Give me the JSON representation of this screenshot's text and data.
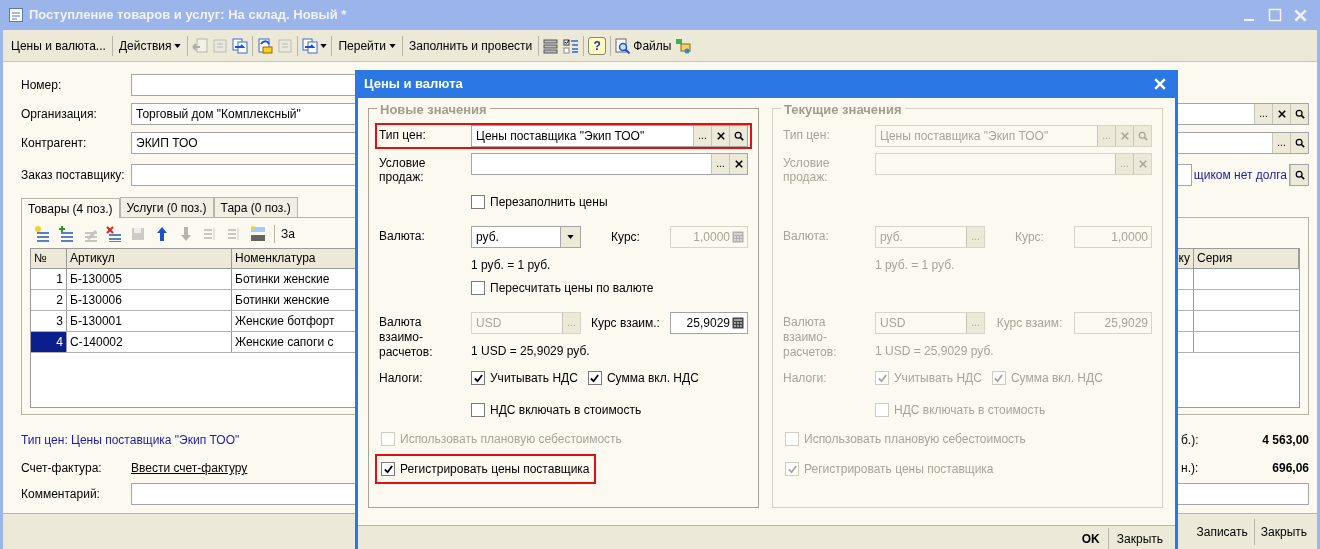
{
  "main_window": {
    "title": "Поступление товаров и услуг: На склад. Новый *",
    "toolbar": [
      [
        {
          "kind": "button",
          "label": "Цены и валюта..."
        }
      ],
      [
        {
          "kind": "menu",
          "label": "Действия"
        }
      ],
      [
        {
          "kind": "icon",
          "disabled": true
        },
        {
          "kind": "icon",
          "disabled": true
        },
        {
          "kind": "icon",
          "disabled": false
        }
      ],
      [
        {
          "kind": "icon",
          "disabled": false
        },
        {
          "kind": "icon",
          "disabled": true
        }
      ],
      [
        {
          "kind": "icon-menu",
          "disabled": false
        }
      ],
      [
        {
          "kind": "menu",
          "label": "Перейти"
        }
      ],
      [
        {
          "kind": "button",
          "label": "Заполнить и провести"
        }
      ],
      [
        {
          "kind": "icon",
          "disabled": false
        },
        {
          "kind": "icon",
          "disabled": false
        }
      ],
      [
        {
          "kind": "help",
          "label": "?"
        }
      ],
      [
        {
          "kind": "icon-button",
          "label": "Файлы"
        },
        {
          "kind": "icon",
          "disabled": false
        }
      ]
    ],
    "fields": [
      {
        "kind": "plain",
        "label": "Номер:"
      },
      {
        "kind": "ref",
        "label": "Организация:",
        "value": "Торговый дом \"Комплексный\"",
        "buttons": [
          {
            "kind": "choose",
            "label": "..."
          },
          {
            "kind": "clear"
          },
          {
            "kind": "open"
          }
        ]
      },
      {
        "kind": "ref",
        "label": "Контрагент:",
        "value": "ЭКИП ТОО",
        "buttons": [
          {
            "kind": "choose",
            "label": "..."
          },
          {
            "kind": "open"
          }
        ]
      },
      {
        "kind": "order",
        "label": "Заказ поставщику:",
        "link": "щиком нет долга",
        "buttons": [
          {
            "kind": "open"
          }
        ]
      }
    ],
    "tabs": [
      {
        "label": "Товары (4 поз.)",
        "selected": true
      },
      {
        "label": "Услуги (0 поз.)",
        "selected": false
      },
      {
        "label": "Тара (0 поз.)",
        "selected": false
      }
    ],
    "table_toolbar": [
      {
        "kind": "icon",
        "disabled": false
      },
      {
        "kind": "icon",
        "disabled": false
      },
      {
        "kind": "icon",
        "disabled": true
      },
      {
        "kind": "icon",
        "disabled": false
      },
      {
        "kind": "icon",
        "disabled": true
      },
      {
        "kind": "icon",
        "disabled": false
      },
      {
        "kind": "icon",
        "disabled": true
      },
      {
        "kind": "icon",
        "disabled": true
      },
      {
        "kind": "icon",
        "disabled": true
      },
      {
        "kind": "icon",
        "disabled": false
      },
      {
        "kind": "button",
        "label": "За"
      }
    ],
    "table": {
      "columns": [
        "№",
        "Артикул",
        "Номенклатура",
        "ку",
        "Серия"
      ],
      "rows": [
        {
          "n": "1",
          "article": "Б-130005",
          "name": "Ботинки женские",
          "selected": false
        },
        {
          "n": "2",
          "article": "Б-130006",
          "name": "Ботинки женские",
          "selected": false
        },
        {
          "n": "3",
          "article": "Б-130001",
          "name": "Женские ботфорт",
          "selected": false
        },
        {
          "n": "4",
          "article": "С-140002",
          "name": "Женские сапоги с",
          "selected": true
        }
      ]
    },
    "price_type_link": "Тип цен: Цены поставщика \"Экип ТОО\"",
    "invoice": {
      "label": "Счет-фактура:",
      "link": "Ввести счет-фактуру"
    },
    "totals": [
      {
        "label": "б.):",
        "value": "4 563,00"
      },
      {
        "label": "н.):",
        "value": "696,06"
      }
    ],
    "comment": {
      "label": "Комментарий:"
    },
    "buttons": [
      {
        "label": "Записать"
      },
      {
        "label": "Закрыть"
      }
    ]
  },
  "dialog": {
    "title": "Цены и валюта",
    "groups": [
      {
        "title": "Новые значения",
        "disabled": false
      },
      {
        "title": "Текущие значения",
        "disabled": true
      }
    ],
    "rows": [
      {
        "kind": "ref",
        "new": {
          "label": "Тип цен:",
          "value": "Цены поставщика \"Экип ТОО\"",
          "highlighted": true,
          "buttons": [
            {
              "kind": "choose",
              "label": "..."
            },
            {
              "kind": "clear"
            },
            {
              "kind": "open"
            }
          ]
        },
        "current": {
          "label": "Тип цен:",
          "value": "Цены поставщика \"Экип ТОО\"",
          "buttons": [
            {
              "kind": "choose",
              "label": "..."
            },
            {
              "kind": "clear"
            },
            {
              "kind": "open"
            }
          ]
        }
      },
      {
        "kind": "ref",
        "new": {
          "label": "Условие продаж:",
          "highlighted": false,
          "buttons": [
            {
              "kind": "choose",
              "label": "..."
            },
            {
              "kind": "clear"
            }
          ]
        },
        "current": {
          "label": "Условие продаж:",
          "buttons": [
            {
              "kind": "choose",
              "label": "..."
            },
            {
              "kind": "clear"
            }
          ]
        }
      },
      {
        "kind": "check",
        "new": {
          "label": "Перезаполнить цены",
          "checked": false,
          "disabled": false
        }
      },
      {
        "kind": "currency",
        "new": {
          "label": "Валюта:",
          "value": "руб.",
          "value_disabled": false,
          "picker": {
            "kind": "dropdown"
          },
          "rate_label": "Курс:",
          "rate": "1,0000",
          "rate_disabled": true,
          "note": "1 руб. = 1 руб."
        },
        "current": {
          "label": "Валюта:",
          "value": "руб.",
          "picker": {
            "kind": "choose",
            "label": "..."
          },
          "rate_label": "Курс:",
          "rate": "1,0000",
          "note": "1 руб. = 1 руб."
        }
      },
      {
        "kind": "check",
        "new": {
          "label": "Пересчитать цены по валюте",
          "checked": false,
          "disabled": false
        }
      },
      {
        "kind": "currency",
        "new": {
          "label": "Валюта взаимо-расчетов:",
          "value": "USD",
          "value_disabled": true,
          "picker": {
            "kind": "choose",
            "label": "..."
          },
          "rate_label": "Курс взаим.:",
          "rate": "25,9029",
          "rate_disabled": false,
          "note": "1 USD = 25,9029 руб."
        },
        "current": {
          "label": "Валюта взаимо-расчетов:",
          "value": "USD",
          "picker": {
            "kind": "choose",
            "label": "..."
          },
          "rate_label": "Курс взаим:",
          "rate": "25,9029",
          "note": "1 USD = 25,9029 руб."
        }
      },
      {
        "kind": "checks",
        "new": {
          "label": "Налоги:",
          "items": [
            {
              "label": "Учитывать НДС",
              "checked": true
            },
            {
              "label": "Сумма вкл. НДС",
              "checked": true
            }
          ]
        },
        "current": {
          "label": "Налоги:",
          "items": [
            {
              "label": "Учитывать НДС",
              "checked": true
            },
            {
              "label": "Сумма вкл. НДС",
              "checked": true
            }
          ]
        }
      },
      {
        "kind": "check",
        "new": {
          "label": "НДС включать в стоимость",
          "checked": false,
          "disabled": false
        },
        "current": {
          "label": "НДС включать в стоимость",
          "checked": false
        }
      },
      {
        "kind": "check-wide",
        "new": {
          "label": "Использовать плановую себестоимость",
          "checked": false,
          "disabled": true,
          "highlighted": false
        },
        "current": {
          "label": "Использовать плановую себестоимость",
          "checked": false
        }
      },
      {
        "kind": "check-wide",
        "new": {
          "label": "Регистрировать цены поставщика",
          "checked": true,
          "disabled": false,
          "highlighted": true
        },
        "current": {
          "label": "Регистрировать цены поставщика",
          "checked": true
        }
      }
    ],
    "buttons": [
      {
        "label": "OK",
        "default": true
      },
      {
        "label": "Закрыть",
        "default": false
      }
    ]
  }
}
